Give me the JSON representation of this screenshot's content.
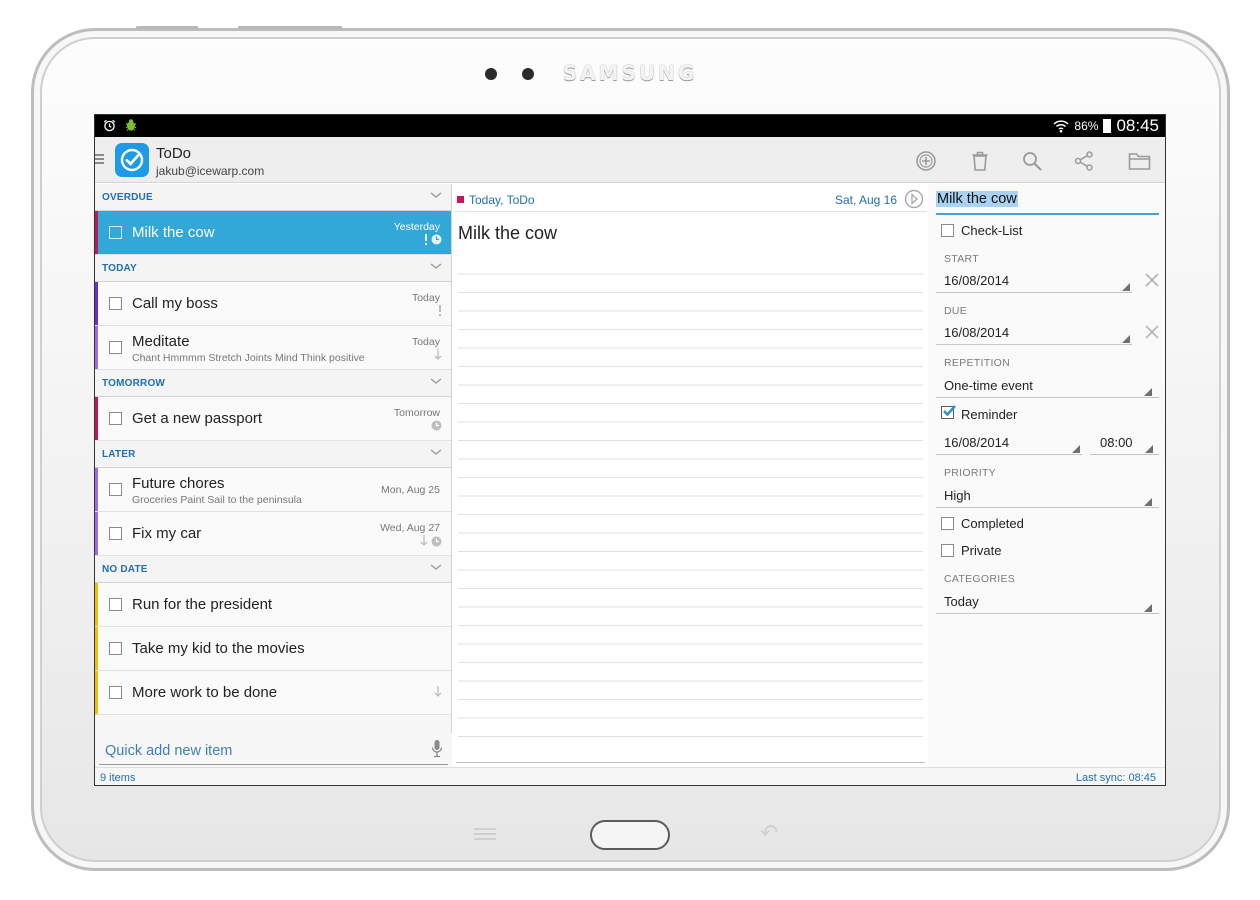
{
  "device": {
    "brand": "SAMSUNG"
  },
  "statusbar": {
    "battery_pct": "86%",
    "clock": "08:45"
  },
  "app": {
    "title": "ToDo",
    "account": "jakub@icewarp.com"
  },
  "actions": [
    "add-icon",
    "trash-icon",
    "search-icon",
    "share-icon",
    "folder-icon"
  ],
  "sections": {
    "overdue": "OVERDUE",
    "today": "TODAY",
    "tomorrow": "TOMORROW",
    "later": "LATER",
    "nodate": "NO DATE"
  },
  "tasks": {
    "milk": {
      "title": "Milk the cow",
      "date": "Yesterday",
      "color": "#c2185b"
    },
    "boss": {
      "title": "Call my boss",
      "date": "Today",
      "color": "#6a2fd0"
    },
    "meditate": {
      "title": "Meditate",
      "sub": "Chant Hmmmm  Stretch Joints  Mind Think positive",
      "date": "Today",
      "color": "#9c6fe0"
    },
    "passport": {
      "title": "Get a new passport",
      "date": "Tomorrow",
      "color": "#c2185b"
    },
    "chores": {
      "title": "Future chores",
      "sub": "Groceries Paint Sail to the peninsula",
      "date": "Mon, Aug 25",
      "color": "#9c6fe0"
    },
    "car": {
      "title": "Fix my car",
      "date": "Wed, Aug 27",
      "color": "#9c6fe0"
    },
    "president": {
      "title": "Run for the president",
      "color": "#f2c200"
    },
    "movies": {
      "title": "Take my kid to the movies",
      "color": "#f2c200"
    },
    "morework": {
      "title": "More work to be done",
      "color": "#f2c200"
    }
  },
  "quick_add": {
    "placeholder": "Quick add new item"
  },
  "footer": {
    "count": "9 items",
    "sync": "Last sync: 08:45"
  },
  "notes": {
    "category": "Today, ToDo",
    "date": "Sat, Aug 16",
    "title": "Milk the cow"
  },
  "detail": {
    "title": "Milk the cow",
    "checklist_label": "Check-List",
    "start_label": "START",
    "start_value": "16/08/2014",
    "due_label": "DUE",
    "due_value": "16/08/2014",
    "repetition_label": "REPETITION",
    "repetition_value": "One-time event",
    "reminder_label": "Reminder",
    "reminder_checked": true,
    "reminder_date": "16/08/2014",
    "reminder_time": "08:00",
    "priority_label": "PRIORITY",
    "priority_value": "High",
    "completed_label": "Completed",
    "private_label": "Private",
    "categories_label": "CATEGORIES",
    "categories_value": "Today"
  }
}
